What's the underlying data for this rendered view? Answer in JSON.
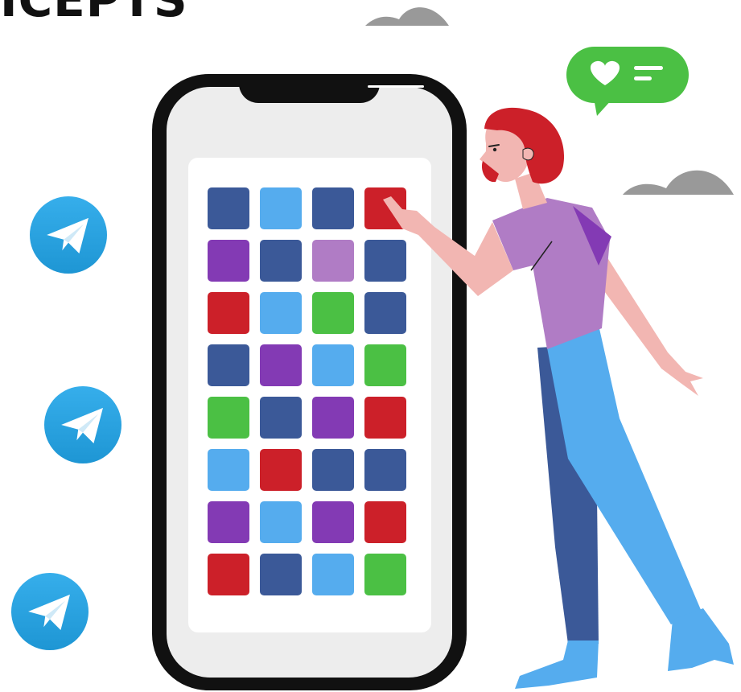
{
  "header": {
    "title": "ICEPTS"
  },
  "colors": {
    "navy": "#3b5998",
    "sky": "#55acee",
    "red": "#cc2029",
    "purple": "#833ab4",
    "lavender": "#b07cc5",
    "green": "#4bc044",
    "telegram": "#2aa3e0",
    "hair": "#cc2029",
    "shirt": "#b07cc5",
    "pants_dark": "#3b5998",
    "pants_light": "#55acee",
    "skin": "#f2b6b2",
    "cloud": "#999999"
  },
  "phone": {
    "app_grid": [
      [
        "navy",
        "sky",
        "navy",
        "red"
      ],
      [
        "purple",
        "navy",
        "lavender",
        "navy"
      ],
      [
        "red",
        "sky",
        "green",
        "navy"
      ],
      [
        "navy",
        "purple",
        "sky",
        "green"
      ],
      [
        "green",
        "navy",
        "purple",
        "red"
      ],
      [
        "sky",
        "red",
        "navy",
        "navy"
      ],
      [
        "purple",
        "sky",
        "purple",
        "red"
      ],
      [
        "red",
        "navy",
        "sky",
        "green"
      ]
    ]
  },
  "icons": {
    "telegram": "telegram-icon",
    "heart": "heart-icon",
    "cloud": "cloud-icon"
  }
}
